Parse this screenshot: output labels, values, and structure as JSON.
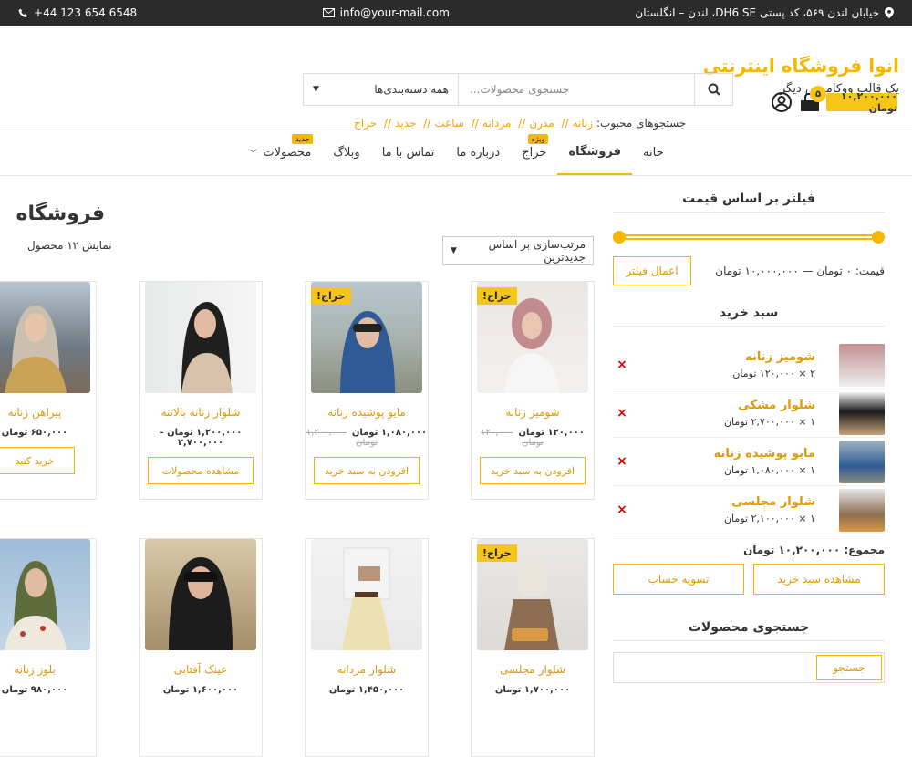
{
  "topbar": {
    "phone": "+44 123 654 6548",
    "email": "info@your-mail.com",
    "address": "خیابان لندن ۵۶۹، کد پستی DH6 SE، لندن – انگلستان"
  },
  "header": {
    "brand": "انوا فروشگاه اینترنتی",
    "tagline": "یک قالب ووکامرس دیگر",
    "category_select": "همه دسته‌بندی‌ها",
    "search_placeholder": "جستجوی محصولات...",
    "popular_label": "جستجوهای محبوب:",
    "popular_terms": [
      "زنانه",
      "مدرن",
      "مردانه",
      "ساعت",
      "جدید",
      "حراج"
    ],
    "cart_total": "۱۰,۲۰۰,۰۰۰ تومان",
    "cart_count": "۵"
  },
  "nav": {
    "items": [
      {
        "label": "خانه"
      },
      {
        "label": "فروشگاه"
      },
      {
        "label": "حراج",
        "badge": "ویژه"
      },
      {
        "label": "درباره ما"
      },
      {
        "label": "تماس با ما"
      },
      {
        "label": "وبلاگ"
      },
      {
        "label": "محصولات",
        "badge": "جدید"
      }
    ]
  },
  "shop": {
    "title": "فروشگاه",
    "result_count": "نمایش ۱۲ محصول",
    "sort": "مرتب‌سازی بر اساس جدیدترین"
  },
  "products": [
    {
      "name": "شومیز زنانه",
      "price": "۱۲۰,۰۰۰ تومان",
      "old_price": "۱۲۰,۰۰۰ تومان",
      "button": "افزودن به سبد خرید",
      "sale": "حراج!"
    },
    {
      "name": "مایو پوشیده زنانه",
      "price": "۱,۰۸۰,۰۰۰ تومان",
      "old_price": "۱,۲۰۰,۰۰۰ تومان",
      "button": "افزودن به سبد خرید",
      "sale": "حراج!"
    },
    {
      "name": "شلوار زنانه بالاتنه",
      "price": "۱,۲۰۰,۰۰۰ تومان – ۲,۷۰۰,۰۰۰",
      "button": "مشاهده محصولات"
    },
    {
      "name": "پیراهن زنانه",
      "price": "۶۵۰,۰۰۰ تومان",
      "button": "خرید کنید"
    },
    {
      "name": "شلوار مجلسی",
      "price": "۱,۷۰۰,۰۰۰ تومان",
      "sale": "حراج!"
    },
    {
      "name": "شلوار مردانه",
      "price": "۱,۴۵۰,۰۰۰ تومان"
    },
    {
      "name": "عینک آفتابی",
      "price": "۱,۶۰۰,۰۰۰ تومان"
    },
    {
      "name": "بلوز زنانه",
      "price": "۹۸۰,۰۰۰ تومان"
    }
  ],
  "sidebar": {
    "filter_title": "فیلتر بر اساس قیمت",
    "price_range": "قیمت: ۰ تومان — ۱۰,۰۰۰,۰۰۰ تومان",
    "filter_button": "اعمال فیلتر",
    "cart_title": "سبد خرید",
    "cart_items": [
      {
        "name": "شومیز زنانه",
        "qty": "۲ × ۱۲۰,۰۰۰ تومان"
      },
      {
        "name": "شلوار مشکی",
        "qty": "۱ × ۲,۷۰۰,۰۰۰ تومان"
      },
      {
        "name": "مایو پوشیده زنانه",
        "qty": "۱ × ۱,۰۸۰,۰۰۰ تومان"
      },
      {
        "name": "شلوار مجلسی",
        "qty": "۱ × ۲,۱۰۰,۰۰۰ تومان"
      }
    ],
    "remove_symbol": "×",
    "subtotal": "مجموع: ۱۰,۲۰۰,۰۰۰ تومان",
    "view_cart": "مشاهده سبد خرید",
    "checkout": "تسویه حساب",
    "search_title": "جستجوی محصولات",
    "search_button": "جستجو"
  }
}
